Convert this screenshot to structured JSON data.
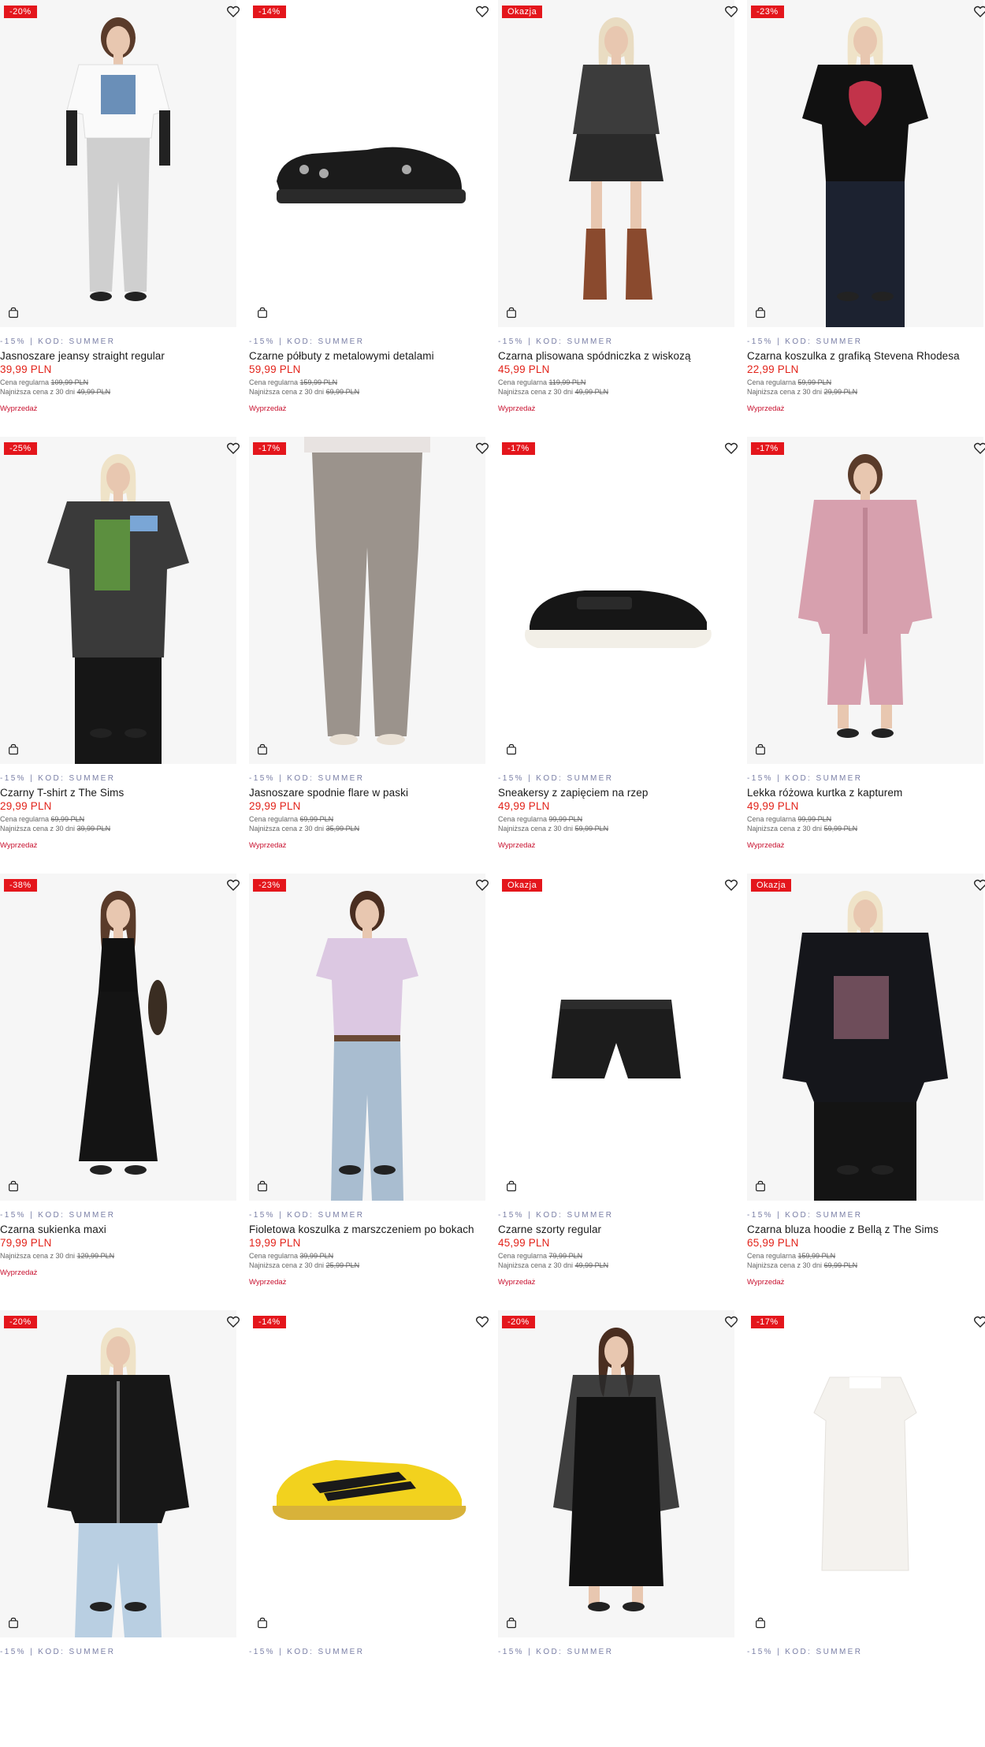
{
  "labels": {
    "promo": "-15% | KOD: SUMMER",
    "regular_prefix": "Cena regularna ",
    "lowest_prefix": "Najniższa cena z 30 dni ",
    "sale": "Wyprzedaż"
  },
  "colors": {
    "badge": "#e4161c",
    "price": "#e2231a",
    "promo": "#7a7fa6",
    "sale": "#c8102e"
  },
  "products": [
    {
      "badge": "-20%",
      "name": "Jasnoszare jeansy straight regular",
      "price": "39,99 PLN",
      "regular": "109,99 PLN",
      "lowest": "49,99 PLN",
      "image": "woman-tshirt-jeans"
    },
    {
      "badge": "-14%",
      "name": "Czarne półbuty z metalowymi detalami",
      "price": "59,99 PLN",
      "regular": "159,99 PLN",
      "lowest": "69,99 PLN",
      "image": "black-shoe"
    },
    {
      "badge": "Okazja",
      "name": "Czarna plisowana spódniczka z wiskozą",
      "price": "45,99 PLN",
      "regular": "119,99 PLN",
      "lowest": "49,99 PLN",
      "image": "woman-skirt-boots"
    },
    {
      "badge": "-23%",
      "name": "Czarna koszulka z grafiką Stevena Rhodesa",
      "price": "22,99 PLN",
      "regular": "59,99 PLN",
      "lowest": "29,99 PLN",
      "image": "woman-black-tee"
    },
    {
      "badge": "-25%",
      "name": "Czarny T-shirt z The Sims",
      "price": "29,99 PLN",
      "regular": "69,99 PLN",
      "lowest": "39,99 PLN",
      "image": "woman-sims-tee"
    },
    {
      "badge": "-17%",
      "name": "Jasnoszare spodnie flare w paski",
      "price": "29,99 PLN",
      "regular": "69,99 PLN",
      "lowest": "35,99 PLN",
      "image": "flare-pants"
    },
    {
      "badge": "-17%",
      "name": "Sneakersy z zapięciem na rzep",
      "price": "49,99 PLN",
      "regular": "99,99 PLN",
      "lowest": "59,99 PLN",
      "image": "black-sneaker"
    },
    {
      "badge": "-17%",
      "name": "Lekka różowa kurtka z kapturem",
      "price": "49,99 PLN",
      "regular": "99,99 PLN",
      "lowest": "59,99 PLN",
      "image": "woman-pink-jacket"
    },
    {
      "badge": "-38%",
      "name": "Czarna sukienka maxi",
      "price": "79,99 PLN",
      "regular": "",
      "lowest": "129,99 PLN",
      "image": "woman-black-maxi"
    },
    {
      "badge": "-23%",
      "name": "Fioletowa koszulka z marszczeniem po bokach",
      "price": "19,99 PLN",
      "regular": "39,99 PLN",
      "lowest": "25,99 PLN",
      "image": "woman-lilac-tee"
    },
    {
      "badge": "Okazja",
      "name": "Czarne szorty regular",
      "price": "45,99 PLN",
      "regular": "79,99 PLN",
      "lowest": "49,99 PLN",
      "image": "black-shorts"
    },
    {
      "badge": "Okazja",
      "name": "Czarna bluza hoodie z Bellą z The Sims",
      "price": "65,99 PLN",
      "regular": "159,99 PLN",
      "lowest": "69,99 PLN",
      "image": "woman-black-hoodie"
    },
    {
      "badge": "-20%",
      "name": "",
      "price": "",
      "regular": "",
      "lowest": "",
      "image": "woman-black-zip"
    },
    {
      "badge": "-14%",
      "name": "",
      "price": "",
      "regular": "",
      "lowest": "",
      "image": "yellow-sneaker"
    },
    {
      "badge": "-20%",
      "name": "",
      "price": "",
      "regular": "",
      "lowest": "",
      "image": "woman-mesh-dress"
    },
    {
      "badge": "-17%",
      "name": "",
      "price": "",
      "regular": "",
      "lowest": "",
      "image": "white-dress"
    }
  ]
}
